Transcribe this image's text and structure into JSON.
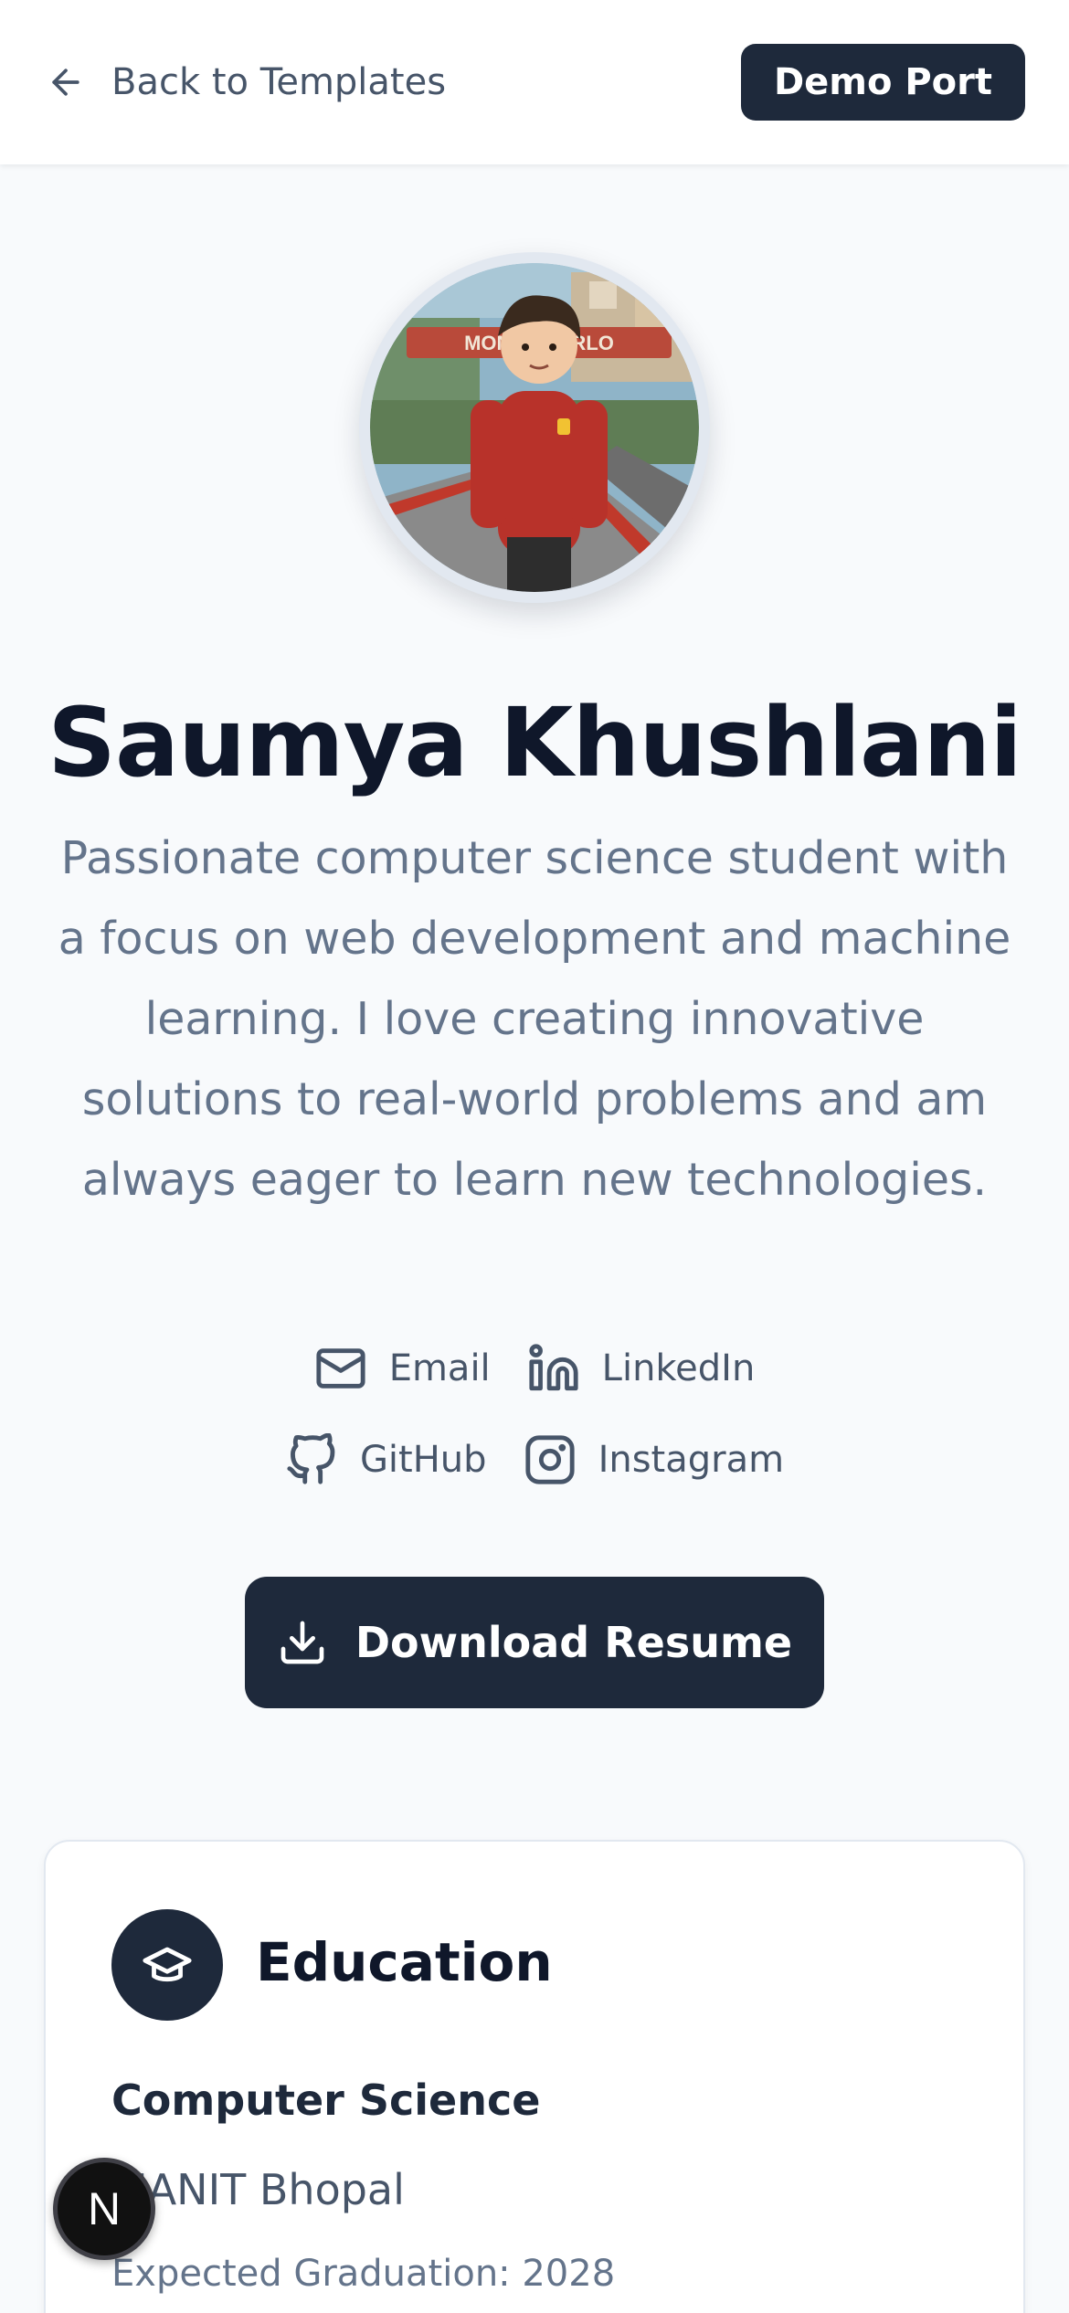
{
  "header": {
    "back_label": "Back to Templates",
    "demo_label": "Demo Port"
  },
  "profile": {
    "name": "Saumya Khushlani",
    "bio": "Passionate computer science student with a focus on web development and machine learning. I love creating innovative solutions to real-world problems and am always eager to learn new technologies.",
    "avatar_sign_text": "MONTE CARLO"
  },
  "links": [
    {
      "label": "Email",
      "icon": "mail-icon"
    },
    {
      "label": "LinkedIn",
      "icon": "linkedin-icon"
    },
    {
      "label": "GitHub",
      "icon": "github-icon"
    },
    {
      "label": "Instagram",
      "icon": "instagram-icon"
    }
  ],
  "actions": {
    "download_label": "Download Resume"
  },
  "education": {
    "title": "Education",
    "degree": "Computer Science",
    "school": "MANIT Bhopal",
    "graduation": "Expected Graduation: 2028"
  },
  "overlay": {
    "badge_letter": "N"
  },
  "colors": {
    "primary": "#1e293b",
    "background": "#f8fafc",
    "muted_text": "#64748b"
  }
}
